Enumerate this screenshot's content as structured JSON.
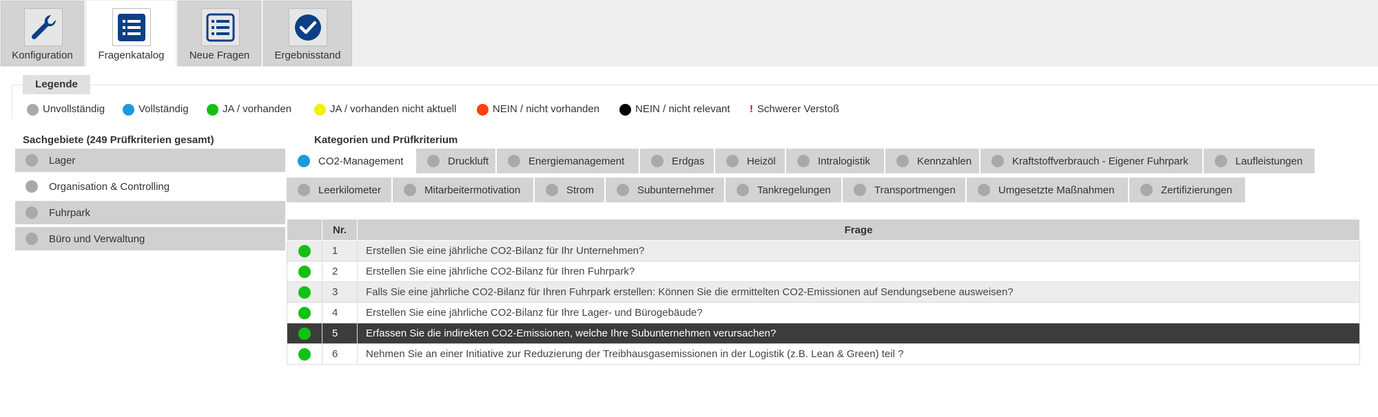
{
  "nav_tabs": [
    {
      "label": "Konfiguration",
      "icon": "wrench-icon"
    },
    {
      "label": "Fragenkatalog",
      "icon": "list-icon"
    },
    {
      "label": "Neue Fragen",
      "icon": "list-icon"
    },
    {
      "label": "Ergebnisstand",
      "icon": "check-circle-icon"
    }
  ],
  "legend": {
    "title": "Legende",
    "items": [
      {
        "label": "Unvollständig",
        "color": "#a9a9a9"
      },
      {
        "label": "Vollständig",
        "color": "#1a9bdb"
      },
      {
        "label": "JA / vorhanden",
        "color": "#13c013"
      },
      {
        "label": "JA / vorhanden nicht aktuell",
        "color": "#f2f200"
      },
      {
        "label": "NEIN / nicht vorhanden",
        "color": "#ff4010"
      },
      {
        "label": "NEIN / nicht relevant",
        "color": "#000000"
      }
    ],
    "severe": {
      "mark": "!",
      "label": "Schwerer Verstoß"
    }
  },
  "sachgebiete": {
    "title": "Sachgebiete (249 Prüfkriterien gesamt)",
    "items": [
      "Lager",
      "Organisation & Controlling",
      "Fuhrpark",
      "Büro und Verwaltung"
    ]
  },
  "kategorien": {
    "title": "Kategorien und Prüfkriterium",
    "row1": [
      "CO2-Management",
      "Druckluft",
      "Energiemanagement",
      "Erdgas",
      "Heizöl",
      "Intralogistik",
      "Kennzahlen",
      "Kraftstoffverbrauch - Eigener Fuhrpark",
      "Laufleistungen"
    ],
    "row2": [
      "Leerkilometer",
      "Mitarbeitermotivation",
      "Strom",
      "Subunternehmer",
      "Tankregelungen",
      "Transportmengen",
      "Umgesetzte Maßnahmen",
      "Zertifizierungen"
    ]
  },
  "table": {
    "headers": {
      "status": "",
      "nr": "Nr.",
      "frage": "Frage"
    },
    "rows": [
      {
        "nr": "1",
        "frage": "Erstellen Sie eine jährliche CO2-Bilanz für Ihr Unternehmen?"
      },
      {
        "nr": "2",
        "frage": "Erstellen Sie eine jährliche CO2-Bilanz für Ihren Fuhrpark?"
      },
      {
        "nr": "3",
        "frage": "Falls Sie eine jährliche CO2-Bilanz für Ihren Fuhrpark erstellen: Können Sie die ermittelten CO2-Emissionen auf Sendungsebene ausweisen?"
      },
      {
        "nr": "4",
        "frage": "Erstellen Sie eine jährliche CO2-Bilanz für Ihre Lager- und Bürogebäude?"
      },
      {
        "nr": "5",
        "frage": "Erfassen Sie die indirekten CO2-Emissionen, welche Ihre Subunternehmen verursachen?"
      },
      {
        "nr": "6",
        "frage": "Nehmen Sie an einer Initiative zur Reduzierung der Treibhausgasemissionen in der Logistik (z.B. Lean & Green) teil ?"
      }
    ]
  },
  "colors": {
    "accent": "#0d3f86",
    "status_yes": "#13c013",
    "selected_row": "#3c3c3c",
    "active_category_dot": "#1a9bdb"
  }
}
